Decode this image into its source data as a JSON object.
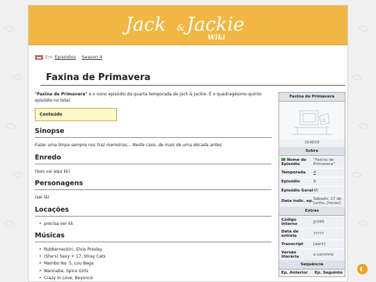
{
  "header": {
    "logo_left": "Jack",
    "logo_amp": "&",
    "logo_right": "Jackie",
    "logo_sub": "Wiki"
  },
  "breadcrumb": {
    "prefix": "Em",
    "links": [
      "Episódios",
      "Season 4"
    ]
  },
  "page": {
    "title": "Faxina de Primavera",
    "intro_bold": "\"Faxina de Primavera\"",
    "intro_1": " é o nono episódio da quarta temporada de ",
    "intro_show": "Jack & Jackie",
    "intro_2": ". É o quadragésimo-quinto episódio no total.",
    "toc_label": "Conteúdo"
  },
  "sections": {
    "sinopse": {
      "heading": "Sinopse",
      "text": "Fazer uma limpa sempre nos traz memórias... Neste caso, de mais de uma década antes."
    },
    "enredo": {
      "heading": "Enredo",
      "text": "(isso vai aqui kk)"
    },
    "personagens": {
      "heading": "Personagens",
      "text": "(sei lá)"
    },
    "locacoes": {
      "heading": "Locações",
      "items": [
        "precisa ver kk"
      ]
    },
    "musicas": {
      "heading": "Músicas",
      "items": [
        "Rubberneckin', Elvis Presley",
        "(She's) Sexy + 17, Stray Cats",
        "Mambo No. 5, Lou Bega",
        "Wannabe, Spice Girls",
        "Crazy In Love, Beyoncé"
      ]
    }
  },
  "infobox": {
    "title": "Faxina de Primavera",
    "caption": "S04E09",
    "section_about": "Sobre",
    "rows": [
      {
        "key": "Nome do Episódio",
        "value": "\"Faxina de Primavera\""
      },
      {
        "key": "Temporada",
        "value": "4"
      },
      {
        "key": "Episódio",
        "value": "9"
      },
      {
        "key": "Episódio Geral",
        "value": "45"
      },
      {
        "key": "Data indic. ep.",
        "value": "Sábado, 27 de junho, [horas]"
      }
    ],
    "section_extras": "Extras",
    "extras": [
      {
        "key": "Código interno",
        "value": "JJ-045"
      },
      {
        "key": "Data de estreia",
        "value": "?????"
      },
      {
        "key": "Transcript",
        "value": "[abrir]"
      },
      {
        "key": "Versão literária",
        "value": "a caminho"
      }
    ],
    "section_seq": "Sequência",
    "prev_label": "Ep. Anterior",
    "next_label": "Ep. Seguinte"
  },
  "colors": {
    "header_bg": "#f2b742",
    "accent": "#f5a015"
  },
  "icons": {
    "flag": "flag-icon",
    "theme": "theme-toggle-icon"
  }
}
